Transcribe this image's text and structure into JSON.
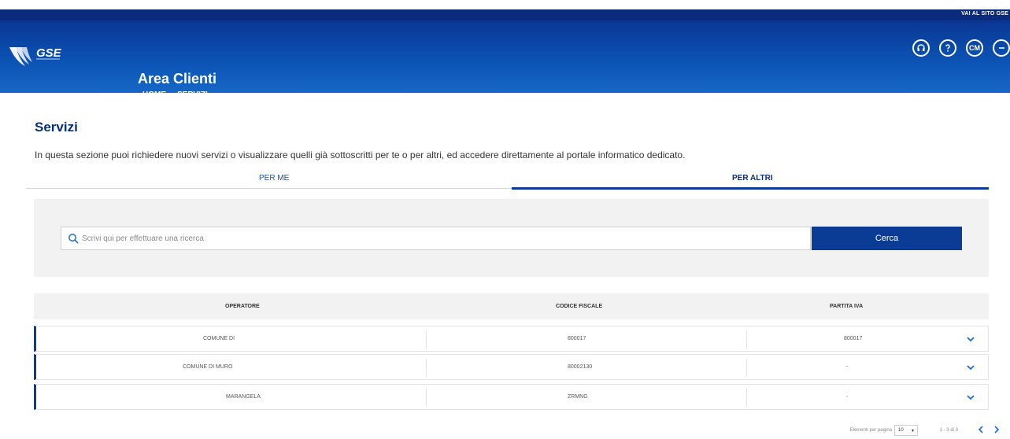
{
  "header": {
    "top_link": "VAI AL SITO GSE",
    "logo_text": "GSE",
    "app_title": "Area Clienti",
    "nav": [
      {
        "label": "HOME"
      },
      {
        "label": "SERVIZI"
      }
    ],
    "icons": [
      "headset-icon",
      "help-icon",
      "cm-icon",
      "logout-icon"
    ],
    "cm_text": "CM",
    "colors": {
      "primary": "#0b3c95",
      "header_gradient_top": "#0b2e8a",
      "header_gradient_bottom": "#1567c6"
    }
  },
  "page": {
    "title": "Servizi",
    "description": "In questa sezione puoi richiedere nuovi servizi o visualizzare quelli già sottoscritti per te o per altri, ed accedere direttamente al portale informatico dedicato."
  },
  "tabs": [
    {
      "label": "PER ME",
      "active": false
    },
    {
      "label": "PER ALTRI",
      "active": true
    }
  ],
  "search": {
    "placeholder": "Scrivi qui per effettuare una ricerca",
    "button_label": "Cerca"
  },
  "table": {
    "columns": [
      "OPERATORE",
      "CODICE FISCALE",
      "PARTITA IVA"
    ],
    "rows": [
      {
        "operatore": "COMUNE DI",
        "codice_fiscale": "800017",
        "partita_iva": "800017"
      },
      {
        "operatore": "COMUNE DI MURO",
        "codice_fiscale": "80002130",
        "partita_iva": "-"
      },
      {
        "operatore": "MARANGELA",
        "codice_fiscale": "ZRMNG",
        "partita_iva": "-"
      }
    ]
  },
  "pagination": {
    "per_page_label": "Elementi per pagina",
    "per_page_value": "10",
    "range": "1 - 3 di 3"
  }
}
